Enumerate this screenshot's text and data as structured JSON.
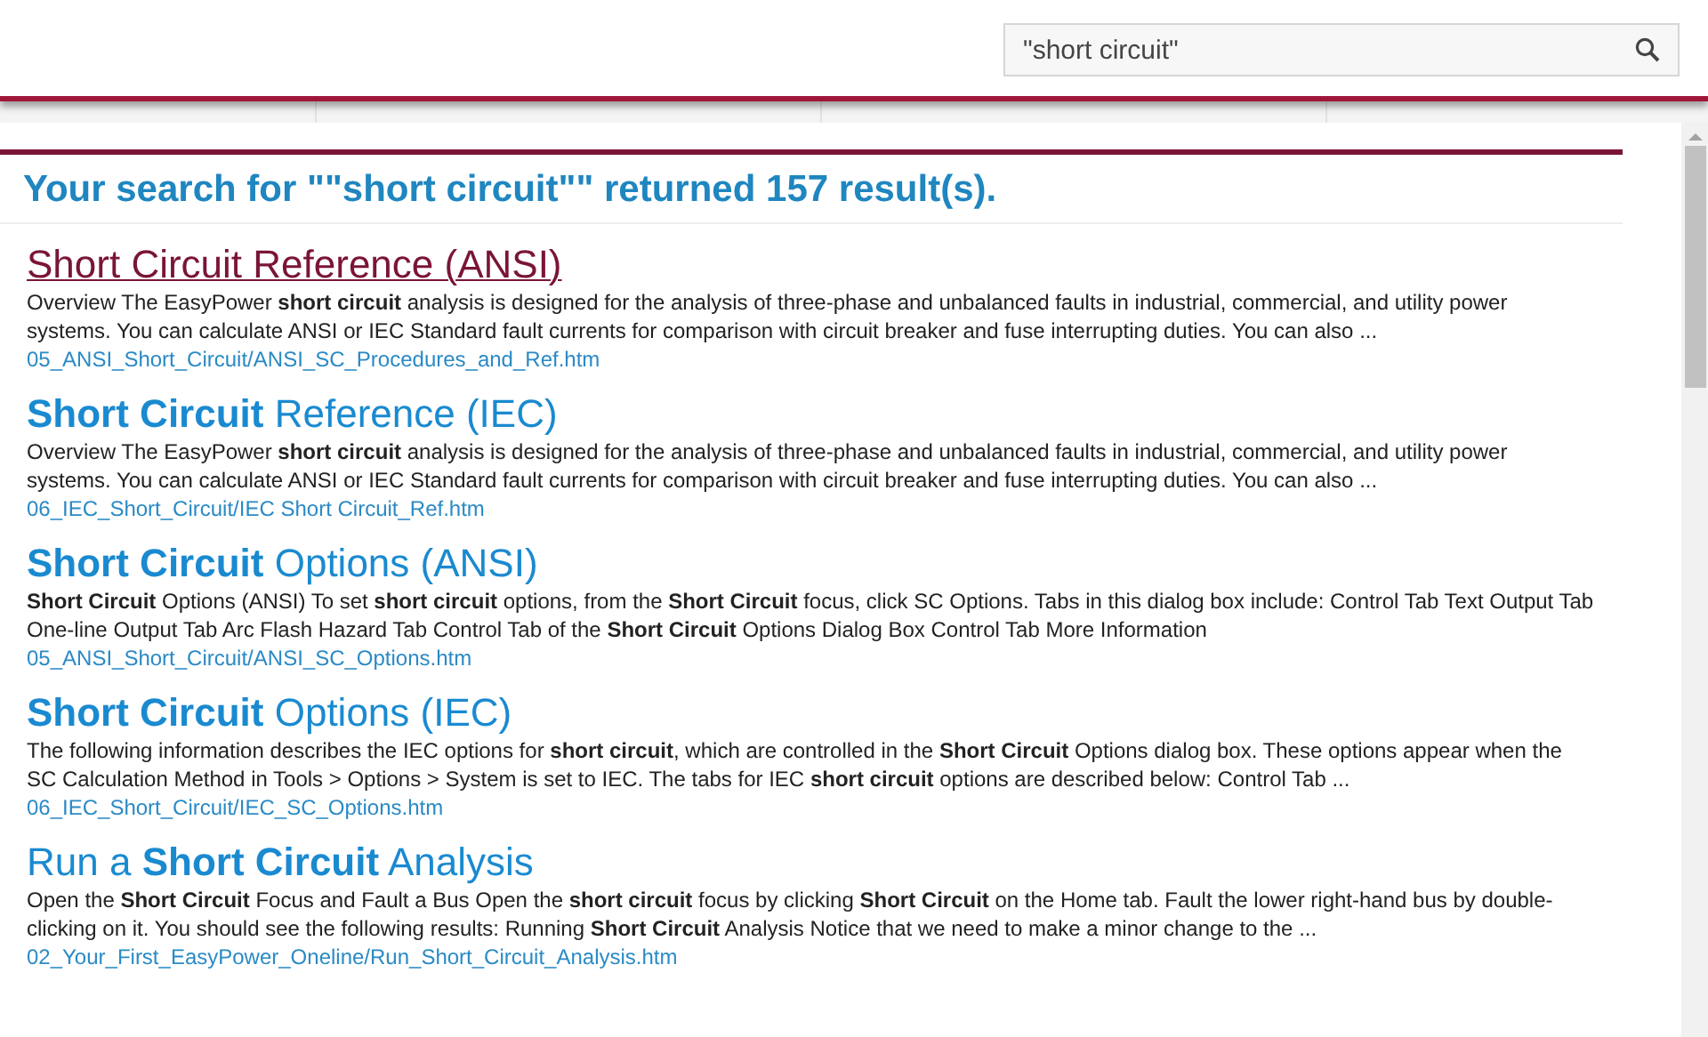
{
  "search": {
    "value": "\"short circuit\""
  },
  "heading": "Your search for \"\"short circuit\"\" returned 157 result(s).",
  "results": [
    {
      "title": "Short Circuit Reference (ANSI)",
      "visited": true,
      "snippet": "Overview The EasyPower **short circuit** analysis is designed for the analysis of three-phase and unbalanced faults in industrial, commercial, and utility power systems. You can calculate ANSI or IEC Standard fault currents for comparison with circuit breaker and fuse interrupting duties. You can also ...",
      "url": "05_ANSI_Short_Circuit/ANSI_SC_Procedures_and_Ref.htm"
    },
    {
      "title": "**Short Circuit** Reference (IEC)",
      "visited": false,
      "snippet": "Overview The EasyPower **short circuit** analysis is designed for the analysis of three-phase and unbalanced faults in industrial, commercial, and utility power systems. You can calculate ANSI or IEC Standard fault currents for comparison with circuit breaker and fuse interrupting duties. You can also ...",
      "url": "06_IEC_Short_Circuit/IEC Short Circuit_Ref.htm"
    },
    {
      "title": "**Short Circuit** Options (ANSI)",
      "visited": false,
      "snippet": "**Short Circuit** Options (ANSI) To set **short circuit** options, from the **Short Circuit** focus, click SC Options. Tabs in this dialog box include: Control Tab Text Output Tab One-line Output Tab Arc Flash Hazard Tab Control Tab of the **Short Circuit** Options Dialog Box Control Tab More Information",
      "url": "05_ANSI_Short_Circuit/ANSI_SC_Options.htm"
    },
    {
      "title": "**Short Circuit** Options (IEC)",
      "visited": false,
      "snippet": "The following information describes the IEC options for **short circuit**, which are controlled in the **Short Circuit** Options dialog box. These options appear when the SC Calculation Method in Tools > Options > System is set to IEC. The tabs for IEC **short circuit** options are described below: Control Tab ...",
      "url": "06_IEC_Short_Circuit/IEC_SC_Options.htm"
    },
    {
      "title": "Run a **Short Circuit** Analysis",
      "visited": false,
      "snippet": "Open the **Short Circuit** Focus and Fault a Bus Open the **short circuit** focus by clicking **Short Circuit** on the Home tab. Fault the lower right-hand bus by double-clicking on it. You should see the following results: Running **Short Circuit** Analysis Notice that we need to make a minor change to the ...",
      "url": "02_Your_First_EasyPower_Oneline/Run_Short_Circuit_Analysis.htm"
    }
  ]
}
